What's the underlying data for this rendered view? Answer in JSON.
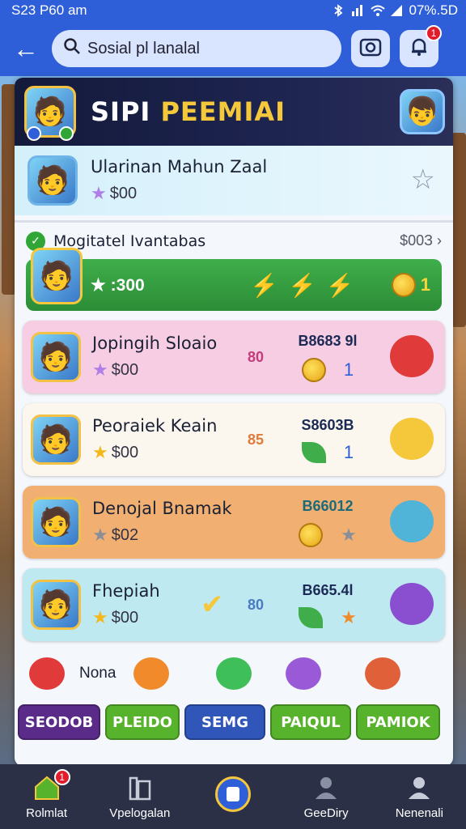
{
  "status_bar": {
    "time": "S23 P60 am",
    "battery": "07%.5D"
  },
  "app_bar": {
    "search_value": "Sosial pl lanalal",
    "notification_count": "1"
  },
  "banner": {
    "title_part1": "SIPI",
    "title_part2": "PEEMIAI"
  },
  "profile": {
    "name": "Ularinan Mahun Zaal",
    "points": "$00"
  },
  "section": {
    "title": "Mogitatel Ivantabas",
    "link": "$00З ›"
  },
  "highlight": {
    "score": ":300",
    "coin_count": "1"
  },
  "players": [
    {
      "name": "Jopingih Sloaio",
      "points": "$00",
      "mid": "80",
      "stat": "B8683 9l",
      "sub": "1",
      "bg": "#f7cde3"
    },
    {
      "name": "Peoraiek Keain",
      "points": "$00",
      "mid": "85",
      "stat": "S8603B",
      "sub": "1",
      "bg": "#fbf7ee"
    },
    {
      "name": "Denojal Bnamak",
      "points": "$02",
      "mid": "",
      "stat": "B66012",
      "sub": "",
      "bg": "#f1b072"
    },
    {
      "name": "Fhepiah",
      "points": "$00",
      "mid": "80",
      "stat": "B665.4l",
      "sub": "",
      "bg": "#bfe9f1"
    }
  ],
  "pets": {
    "label": "Nona"
  },
  "chips": [
    {
      "label": "SEODOB",
      "color": "#5b2b8a"
    },
    {
      "label": "PLEIDO",
      "color": "#58b32c"
    },
    {
      "label": "SEMG",
      "color": "#2f56b8"
    },
    {
      "label": "PAIQUL",
      "color": "#58b32c"
    },
    {
      "label": "PAMIOK",
      "color": "#58b32c"
    }
  ],
  "nav": [
    {
      "label": "Rolmlat",
      "icon": "home-icon",
      "badge": "1"
    },
    {
      "label": "Vpelogalan",
      "icon": "library-icon"
    },
    {
      "label": "",
      "icon": "app-center-icon"
    },
    {
      "label": "GeeDiry",
      "icon": "profile-icon"
    },
    {
      "label": "Nenenali",
      "icon": "user-icon"
    }
  ]
}
